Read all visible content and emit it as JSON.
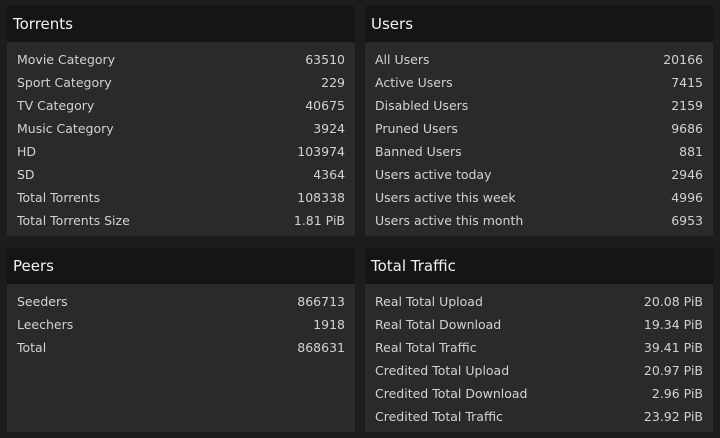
{
  "torrents": {
    "title": "Torrents",
    "rows": [
      {
        "label": "Movie Category",
        "value": "63510"
      },
      {
        "label": "Sport Category",
        "value": "229"
      },
      {
        "label": "TV Category",
        "value": "40675"
      },
      {
        "label": "Music Category",
        "value": "3924"
      },
      {
        "label": "HD",
        "value": "103974"
      },
      {
        "label": "SD",
        "value": "4364"
      },
      {
        "label": "Total Torrents",
        "value": "108338"
      },
      {
        "label": "Total Torrents Size",
        "value": "1.81 PiB"
      }
    ]
  },
  "users": {
    "title": "Users",
    "rows": [
      {
        "label": "All Users",
        "value": "20166"
      },
      {
        "label": "Active Users",
        "value": "7415"
      },
      {
        "label": "Disabled Users",
        "value": "2159"
      },
      {
        "label": "Pruned Users",
        "value": "9686"
      },
      {
        "label": "Banned Users",
        "value": "881"
      },
      {
        "label": "Users active today",
        "value": "2946"
      },
      {
        "label": "Users active this week",
        "value": "4996"
      },
      {
        "label": "Users active this month",
        "value": "6953"
      }
    ]
  },
  "peers": {
    "title": "Peers",
    "rows": [
      {
        "label": "Seeders",
        "value": "866713"
      },
      {
        "label": "Leechers",
        "value": "1918"
      },
      {
        "label": "Total",
        "value": "868631"
      }
    ]
  },
  "traffic": {
    "title": "Total Traffic",
    "rows": [
      {
        "label": "Real Total Upload",
        "value": "20.08 PiB"
      },
      {
        "label": "Real Total Download",
        "value": "19.34 PiB"
      },
      {
        "label": "Real Total Traffic",
        "value": "39.41 PiB"
      },
      {
        "label": "Credited Total Upload",
        "value": "20.97 PiB"
      },
      {
        "label": "Credited Total Download",
        "value": "2.96 PiB"
      },
      {
        "label": "Credited Total Traffic",
        "value": "23.92 PiB"
      }
    ]
  }
}
